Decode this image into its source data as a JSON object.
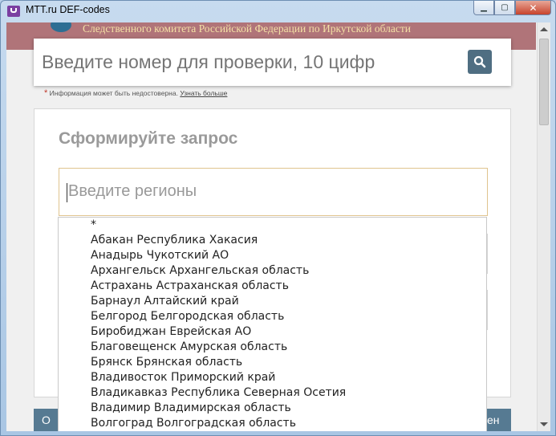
{
  "window": {
    "title": "MTT.ru DEF-codes",
    "controls": {
      "minimize": "▁",
      "maximize": "▢",
      "close": "✕"
    }
  },
  "banner": {
    "text": "Следственного комитета Российской Федерации по Иркутской области"
  },
  "search": {
    "placeholder": "Введите номер для проверки, 10 цифр",
    "icon": "search-icon"
  },
  "note": {
    "star": "*",
    "text": "Информация может быть недостоверна.",
    "link": "Узнать больше"
  },
  "form": {
    "title": "Сформируйте запрос",
    "regions_placeholder": "Введите регионы"
  },
  "dropdown": {
    "items": [
      "*",
      "Абакан Республика Хакасия",
      "Анадырь Чукотский АО",
      "Архангельск Архангельская область",
      "Астрахань Астраханская область",
      "Барнаул Алтайский край",
      "Белгород Белгородская область",
      "Биробиджан Еврейская АО",
      "Благовещенск Амурская область",
      "Брянск Брянская область",
      "Владивосток Приморский край",
      "Владикавказ Республика Северная Осетия",
      "Владимир Владимирская область",
      "Волгоград Волгоградская область"
    ]
  },
  "bottom": {
    "left_label": "О",
    "right_label": "ен"
  },
  "colors": {
    "accent": "#567a92",
    "input_border": "#e0c48f",
    "banner": "#b07479"
  }
}
